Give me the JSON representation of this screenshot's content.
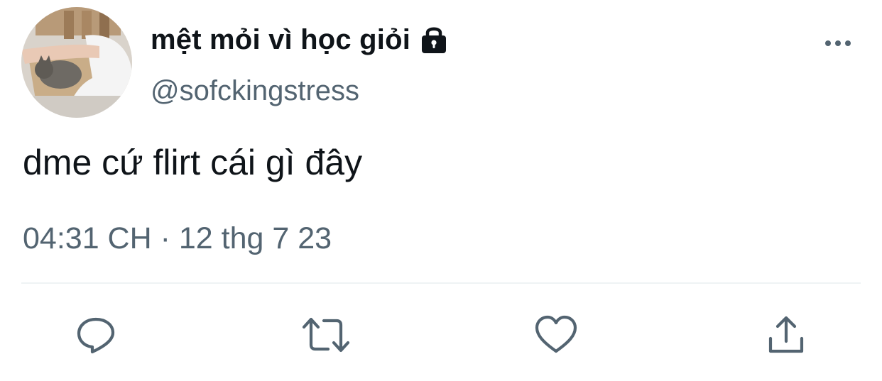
{
  "tweet": {
    "display_name": "mệt mỏi vì học giỏi",
    "handle": "@sofckingstress",
    "protected_icon": "lock-icon",
    "text": "dme cứ flirt cái gì đây",
    "timestamp": "04:31 CH · 12 thg 7 23",
    "avatar": "profile-photo-cat"
  },
  "actions": {
    "reply_icon": "reply-icon",
    "retweet_icon": "retweet-icon",
    "like_icon": "heart-icon",
    "share_icon": "share-icon",
    "more_icon": "more-icon"
  },
  "colors": {
    "text_primary": "#0f1419",
    "text_secondary": "#536471",
    "icon": "#536471",
    "divider": "#eff3f4"
  }
}
